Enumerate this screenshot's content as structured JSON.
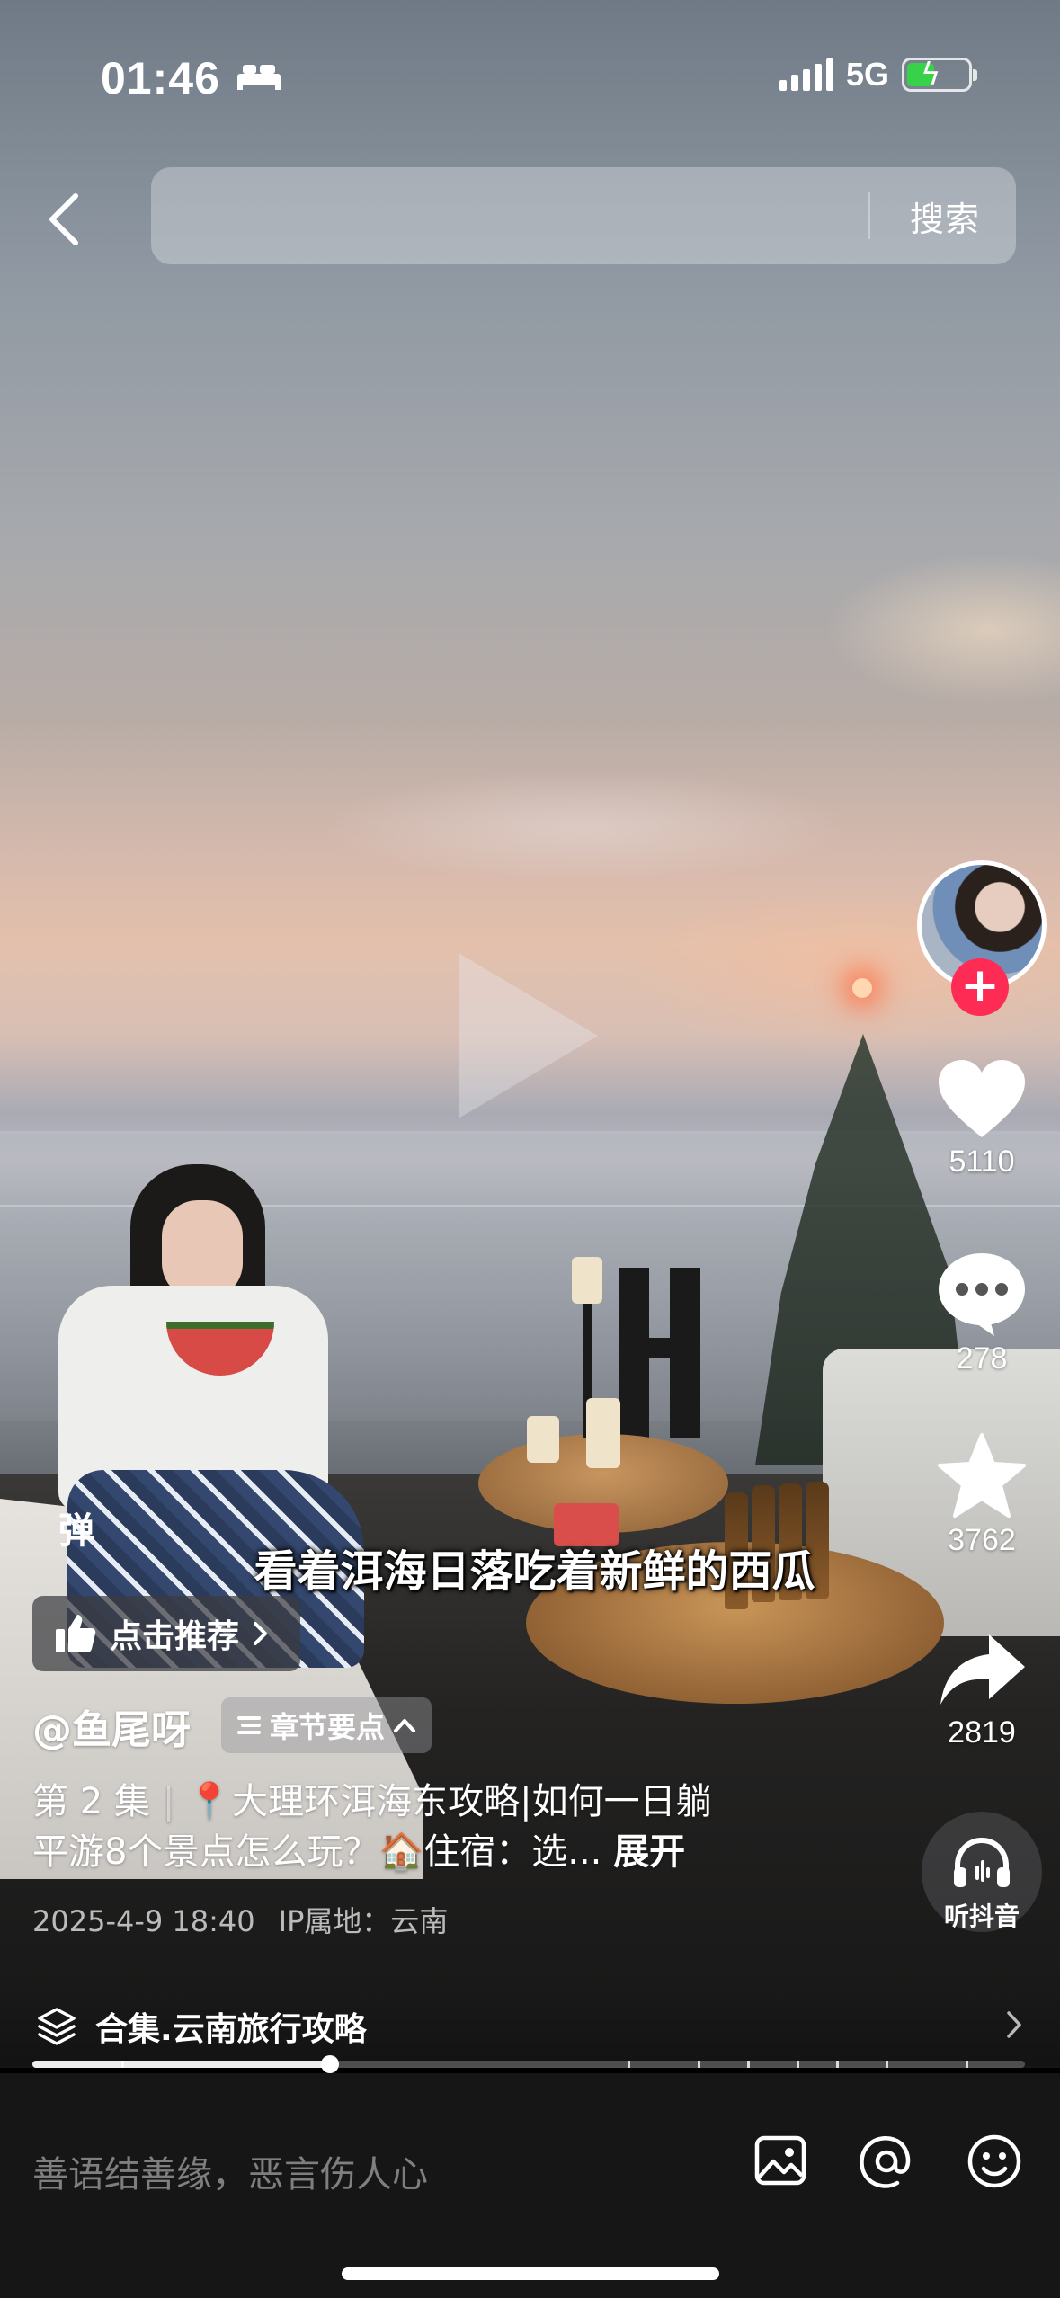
{
  "status_bar": {
    "time": "01:46",
    "network": "5G",
    "battery_level": 0.45,
    "battery_color": "#38d24a"
  },
  "search": {
    "back_icon": "chevron-left-icon",
    "button_label": "搜索"
  },
  "video": {
    "caption": "看着洱海日落吃着新鲜的西瓜",
    "danmaku_label": "弹",
    "playback_progress": 0.3
  },
  "actions": {
    "follow_icon": "plus-icon",
    "like_count": "5110",
    "comment_count": "278",
    "favorite_count": "3762",
    "share_count": "2819",
    "listen_label": "听抖音",
    "follow_color": "#fe2c55"
  },
  "recommend": {
    "label": "点击推荐"
  },
  "post": {
    "author": "@鱼尾呀",
    "chapter_label": "章节要点",
    "episode": "第 2 集",
    "desc_line1": "📍大理环洱海东攻略|如何一日躺",
    "desc_line2": "平游8个景点怎么玩？🏠住宿：选...",
    "expand_label": "展开",
    "datetime": "2025-4-9 18:40",
    "ip_location": "IP属地：云南"
  },
  "collection": {
    "label": "合集.云南旅行攻略"
  },
  "comment_bar": {
    "placeholder": "善语结善缘，恶言伤人心"
  }
}
